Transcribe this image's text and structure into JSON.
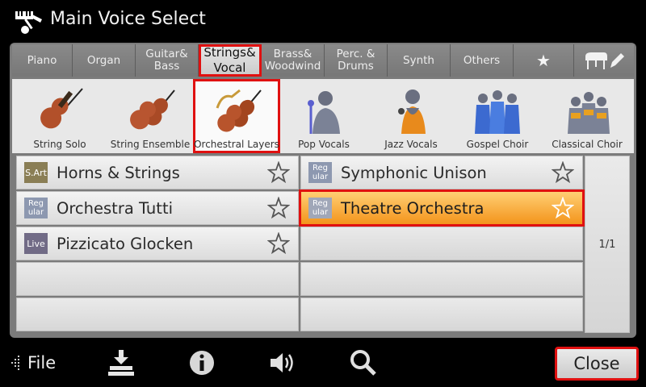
{
  "title": "Main Voice Select",
  "tabs": [
    {
      "label": "Piano"
    },
    {
      "label": "Organ"
    },
    {
      "label": "Guitar&\nBass"
    },
    {
      "label": "Strings&\nVocal"
    },
    {
      "label": "Brass&\nWoodwind"
    },
    {
      "label": "Perc. &\nDrums"
    },
    {
      "label": "Synth"
    },
    {
      "label": "Others"
    },
    {
      "label": "★"
    }
  ],
  "subcategories": [
    {
      "label": "String Solo",
      "icon": "violin-icon"
    },
    {
      "label": "String Ensemble",
      "icon": "violins-icon"
    },
    {
      "label": "Orchestral Layers",
      "icon": "orchestra-icon"
    },
    {
      "label": "Pop Vocals",
      "icon": "singer-icon"
    },
    {
      "label": "Jazz Vocals",
      "icon": "jazz-singer-icon"
    },
    {
      "label": "Gospel Choir",
      "icon": "choir-icon"
    },
    {
      "label": "Classical Choir",
      "icon": "classical-choir-icon"
    }
  ],
  "voices": {
    "left": [
      {
        "badge": "S.Art",
        "name": "Horns & Strings"
      },
      {
        "badge": "Reg\nular",
        "name": "Orchestra Tutti"
      },
      {
        "badge": "Live",
        "name": "Pizzicato Glocken"
      }
    ],
    "right": [
      {
        "badge": "Reg\nular",
        "name": "Symphonic Unison"
      },
      {
        "badge": "Reg\nular",
        "name": "Theatre Orchestra"
      }
    ]
  },
  "pager": "1/1",
  "bottom": {
    "file_label": "File",
    "close_label": "Close"
  },
  "colors": {
    "selection_outline": "#e01010",
    "selected_voice": "#f3941c",
    "panel": "#7b7b7b"
  }
}
